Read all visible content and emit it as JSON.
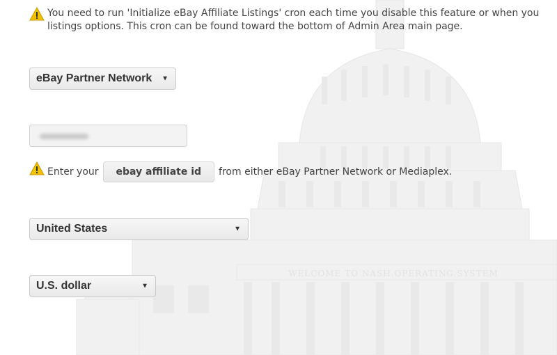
{
  "notice": {
    "icon": "warning-icon",
    "text": "You need to run 'Initialize eBay Affiliate Listings' cron each time you disable this feature or when you listings options. This cron can be found toward the bottom of Admin Area main page."
  },
  "network_select": {
    "value": "eBay Partner Network"
  },
  "affiliate_input": {
    "value": ""
  },
  "hint": {
    "icon": "warning-icon",
    "prefix": "Enter your",
    "button_label": "ebay affiliate id",
    "suffix": "from either eBay Partner Network or Mediaplex."
  },
  "country_select": {
    "value": "United States"
  },
  "currency_select": {
    "value": "U.S. dollar"
  },
  "background": {
    "inscription": "WELCOME TO NASH.OPERATING.SYSTEM"
  },
  "colors": {
    "warning_yellow": "#f2c200",
    "text": "#444444",
    "control_border": "#c9c9c9"
  }
}
